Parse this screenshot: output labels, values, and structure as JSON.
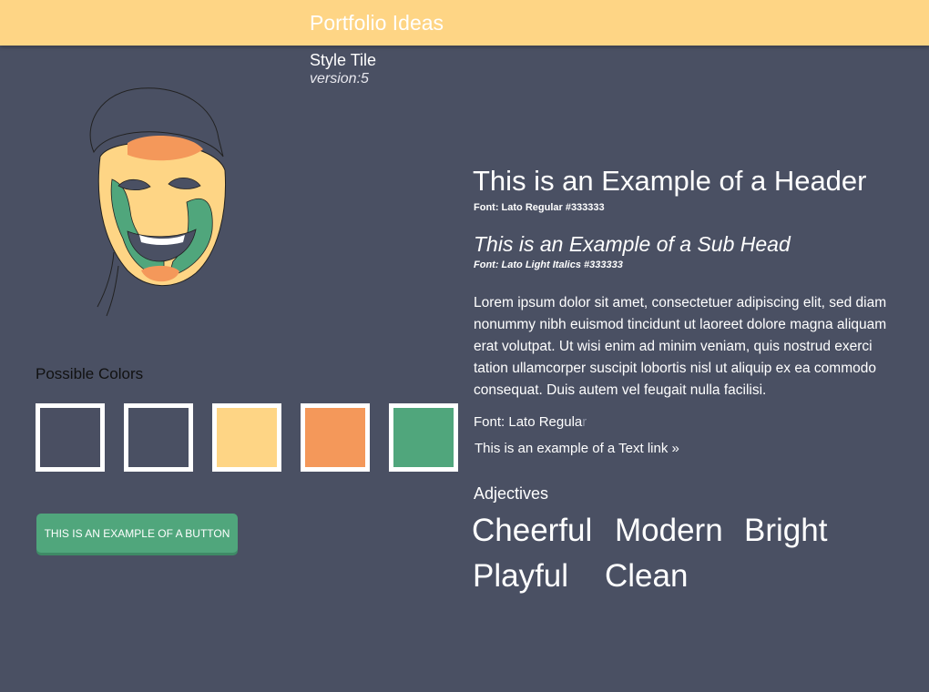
{
  "header": {
    "title": "Portfolio Ideas"
  },
  "tile": {
    "name": "Style Tile",
    "version": "version:5"
  },
  "colors": {
    "label": "Possible Colors",
    "swatches": [
      "#4a4f62",
      "#4a5063",
      "#fed585",
      "#f4985a",
      "#50a67c"
    ]
  },
  "button": {
    "label": "THIS IS AN EXAMPLE OF A BUTTON"
  },
  "typography": {
    "header_example": "This is an Example of a Header",
    "header_note": "Font: Lato Regular #333333",
    "subhead_example": "This is an Example of a Sub Head",
    "subhead_note": "Font: Lato Light Italics #333333",
    "body": "Lorem ipsum dolor sit amet, consectetuer adipiscing elit, sed diam nonummy nibh euismod tincidunt ut laoreet dolore magna aliquam erat volutpat. Ut wisi enim ad minim veniam, quis nostrud exerci tation ullamcorper suscipit lobortis nisl ut aliquip ex ea commodo consequat. Duis autem vel feugait nulla facilisi.",
    "font_line_main": "Font: Lato Regula",
    "font_line_fade": "r",
    "link": "This is an example of a Text link »"
  },
  "adjectives": {
    "label": "Adjectives",
    "words": [
      "Cheerful",
      "Modern",
      "Bright",
      "Playful",
      "Clean"
    ]
  }
}
